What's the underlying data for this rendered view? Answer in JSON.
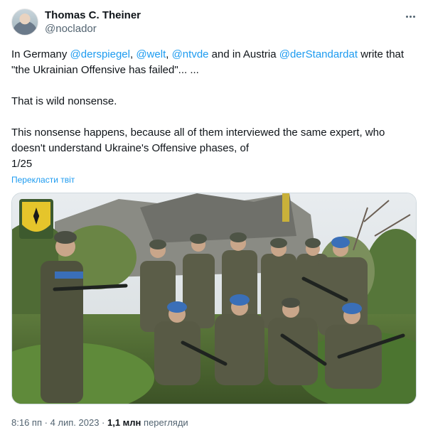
{
  "author": {
    "name": "Thomas C. Theiner",
    "handle": "@noclador"
  },
  "tweet": {
    "line1": {
      "t1": "In Germany ",
      "m1": "@derspiegel",
      "t2": ", ",
      "m2": "@welt",
      "t3": ", ",
      "m3": "@ntvde",
      "t4": " and in Austria ",
      "m4": "@derStandardat",
      "t5": " write that"
    },
    "line2": "\"the Ukrainian Offensive has failed\"... ...",
    "line3": "That is wild nonsense.",
    "line4": "This nonsense happens, because all of them interviewed the same expert, who",
    "line5": "doesn't understand Ukraine's Offensive phases, of",
    "line6": "1/25",
    "translate_label": "Перекласти твіт"
  },
  "media": {
    "description_icon": "soldiers-photo",
    "emblem_icon": "brigade-emblem-icon"
  },
  "footer": {
    "time": "8:16 пп",
    "separator": " · ",
    "date": "4 лип. 2023",
    "views_count": "1,1 млн",
    "views_label": " перегляди"
  },
  "icons": {
    "more": "more-dots-icon"
  },
  "colors": {
    "link": "#1d9bf0",
    "secondary_text": "#536471",
    "primary_text": "#0f1419"
  }
}
